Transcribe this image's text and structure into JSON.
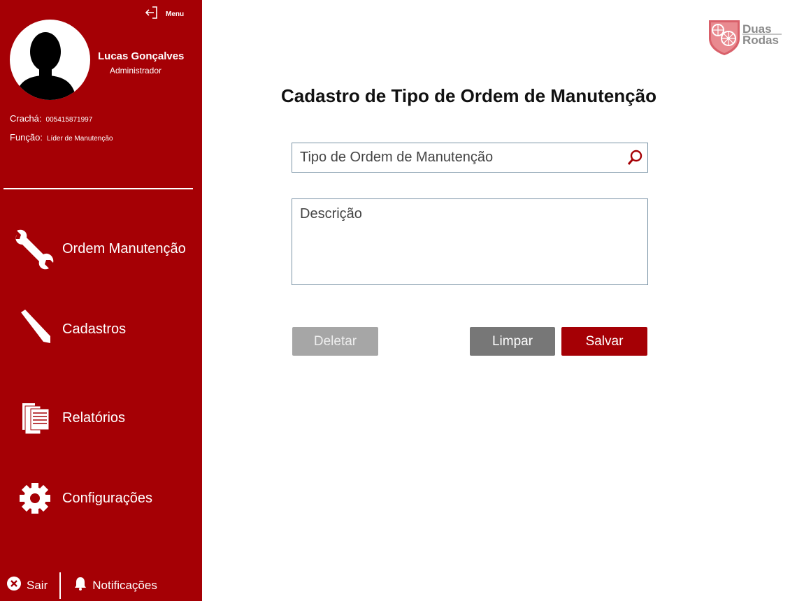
{
  "colors": {
    "brand": "#a50005",
    "sidebar_text": "#ffffff",
    "delete_button": "#a6a6a6",
    "clear_button": "#777777"
  },
  "sidebar": {
    "menu_label": "Menu",
    "user": {
      "name": "Lucas Gonçalves",
      "role": "Administrador",
      "badge_label": "Crachá:",
      "badge_value": "005415871997",
      "function_label": "Função:",
      "function_value": "Líder de Manutenção"
    },
    "nav": [
      {
        "label": "Ordem Manutenção",
        "icon": "wrench-icon"
      },
      {
        "label": "Cadastros",
        "icon": "pencil-icon"
      },
      {
        "label": "Relatórios",
        "icon": "documents-icon"
      },
      {
        "label": "Configurações",
        "icon": "gear-icon"
      }
    ],
    "footer": {
      "exit_label": "Sair",
      "notifications_label": "Notificações"
    }
  },
  "logo": {
    "line1": "Duas",
    "line2": "Rodas"
  },
  "main": {
    "title": "Cadastro de Tipo de Ordem de Manutenção",
    "order_type_placeholder": "Tipo de Ordem de Manutenção",
    "description_placeholder": "Descrição",
    "buttons": {
      "delete": "Deletar",
      "clear": "Limpar",
      "save": "Salvar"
    }
  }
}
